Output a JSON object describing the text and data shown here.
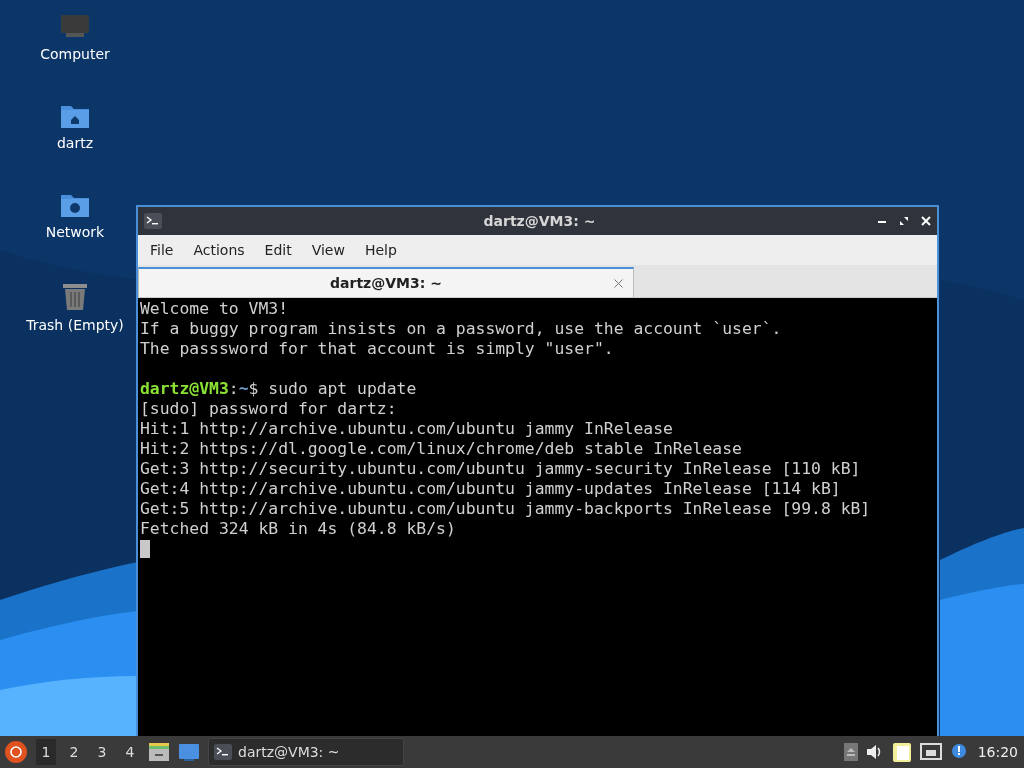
{
  "desktop_icons": [
    {
      "kind": "computer",
      "label": "Computer"
    },
    {
      "kind": "home",
      "label": "dartz"
    },
    {
      "kind": "network",
      "label": "Network"
    },
    {
      "kind": "trash",
      "label": "Trash (Empty)"
    }
  ],
  "window": {
    "title": "dartz@VM3: ~",
    "menu": [
      "File",
      "Actions",
      "Edit",
      "View",
      "Help"
    ],
    "tabs": [
      {
        "label": "dartz@VM3: ~",
        "selected": true
      }
    ],
    "terminal": {
      "lines": [
        {
          "kind": "text",
          "text": "Welcome to VM3!"
        },
        {
          "kind": "text",
          "text": "If a buggy program insists on a password, use the account `user`."
        },
        {
          "kind": "text",
          "text": "The passsword for that account is simply \"user\"."
        },
        {
          "kind": "blank"
        },
        {
          "kind": "prompt",
          "user": "dartz@VM3",
          "sep": ":",
          "path": "~",
          "command": "$ sudo apt update"
        },
        {
          "kind": "text",
          "text": "[sudo] password for dartz:"
        },
        {
          "kind": "text",
          "text": "Hit:1 http://archive.ubuntu.com/ubuntu jammy InRelease"
        },
        {
          "kind": "text",
          "text": "Hit:2 https://dl.google.com/linux/chrome/deb stable InRelease"
        },
        {
          "kind": "text",
          "text": "Get:3 http://security.ubuntu.com/ubuntu jammy-security InRelease [110 kB]"
        },
        {
          "kind": "text",
          "text": "Get:4 http://archive.ubuntu.com/ubuntu jammy-updates InRelease [114 kB]"
        },
        {
          "kind": "text",
          "text": "Get:5 http://archive.ubuntu.com/ubuntu jammy-backports InRelease [99.8 kB]"
        },
        {
          "kind": "text",
          "text": "Fetched 324 kB in 4s (84.8 kB/s)"
        }
      ],
      "cursor": true
    }
  },
  "taskbar": {
    "workspaces": [
      {
        "label": "1",
        "selected": true
      },
      {
        "label": "2",
        "selected": false
      },
      {
        "label": "3",
        "selected": false
      },
      {
        "label": "4",
        "selected": false
      }
    ],
    "tasks": [
      {
        "label": "dartz@VM3: ~",
        "selected": false
      }
    ],
    "clock": "16:20"
  }
}
